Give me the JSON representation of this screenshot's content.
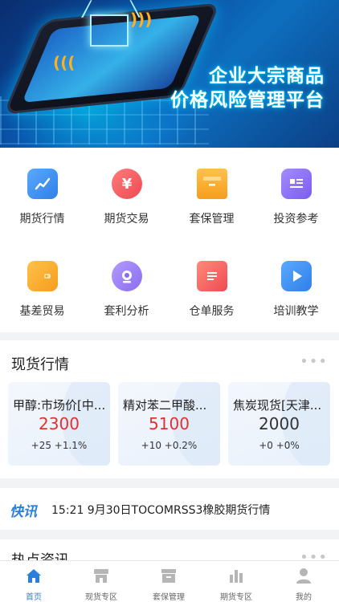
{
  "banner": {
    "title_line1": "企业大宗商品",
    "title_line2": "价格风险管理平台"
  },
  "grid": {
    "items": [
      {
        "label": "期货行情",
        "icon": "line-chart-icon",
        "color": "#3b8fef"
      },
      {
        "label": "期货交易",
        "icon": "yuan-icon",
        "color": "#f0565b"
      },
      {
        "label": "套保管理",
        "icon": "archive-box-icon",
        "color": "#f6a723"
      },
      {
        "label": "投资参考",
        "icon": "article-icon",
        "color": "#8a6cf0"
      },
      {
        "label": "基差贸易",
        "icon": "wallet-icon",
        "color": "#f6a723"
      },
      {
        "label": "套利分析",
        "icon": "webcam-icon",
        "color": "#8a6cf0"
      },
      {
        "label": "仓单服务",
        "icon": "document-icon",
        "color": "#f0565b"
      },
      {
        "label": "培训教学",
        "icon": "play-icon",
        "color": "#3b8fef"
      }
    ]
  },
  "spot": {
    "title": "现货行情",
    "more": "•••",
    "cards": [
      {
        "name": "甲醇:市场价[中...",
        "price": "2300",
        "change": "+25 +1.1%",
        "price_color": "#e0312f"
      },
      {
        "name": "精对苯二甲酸...",
        "price": "5100",
        "change": "+10 +0.2%",
        "price_color": "#e0312f"
      },
      {
        "name": "焦炭现货[天津...",
        "price": "2000",
        "change": "+0 +0%",
        "price_color": "#333333"
      }
    ]
  },
  "flash": {
    "logo": "快讯",
    "text": "15:21 9月30日TOCOMRSS3橡胶期货行情"
  },
  "hot": {
    "title": "热点资讯",
    "more": "•••"
  },
  "tabbar": {
    "active_color": "#2b7fdc",
    "inactive_color": "#b5b5b5",
    "tabs": [
      {
        "label": "首页",
        "icon": "home-icon",
        "active": true
      },
      {
        "label": "现货专区",
        "icon": "store-icon",
        "active": false
      },
      {
        "label": "套保管理",
        "icon": "archive-box-icon",
        "active": false
      },
      {
        "label": "期货专区",
        "icon": "bar-chart-icon",
        "active": false
      },
      {
        "label": "我的",
        "icon": "user-icon",
        "active": false
      }
    ]
  }
}
